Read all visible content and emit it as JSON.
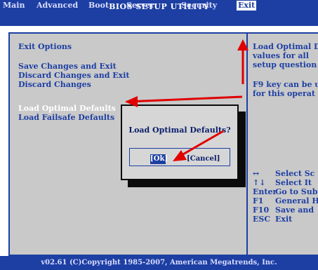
{
  "title": "BIOS SETUP UTILITY",
  "menu": {
    "items": [
      "Main",
      "Advanced",
      "Boot",
      "Server",
      "Security",
      "Exit"
    ],
    "active": "Exit"
  },
  "left": {
    "section_title": "Exit Options",
    "options": [
      "Save Changes and Exit",
      "Discard Changes and Exit",
      "Discard Changes"
    ],
    "defaults": [
      "Load Optimal Defaults",
      "Load Failsafe Defaults"
    ]
  },
  "help": {
    "description_lines": [
      "Load Optimal De",
      "values for all",
      "setup question"
    ],
    "f9_lines": [
      "F9 key can be u",
      "for this operat"
    ],
    "keys": [
      {
        "key": "↔",
        "desc": "Select Sc"
      },
      {
        "key": "↑↓",
        "desc": "Select It"
      },
      {
        "key": "Enter",
        "desc": "Go to Sub"
      },
      {
        "key": "F1",
        "desc": "General H"
      },
      {
        "key": "F10",
        "desc": "Save and"
      },
      {
        "key": "ESC",
        "desc": "Exit"
      }
    ]
  },
  "dialog": {
    "title": "Load Optimal Defaults?",
    "ok_label": "[Ok]",
    "cancel_label": "[Cancel]"
  },
  "footer": "v02.61 (C)Copyright 1985-2007, American Megatrends, Inc.",
  "colors": {
    "blue": "#1d3fa3",
    "panel": "#c9c9c9",
    "arrow": "#e00000"
  }
}
